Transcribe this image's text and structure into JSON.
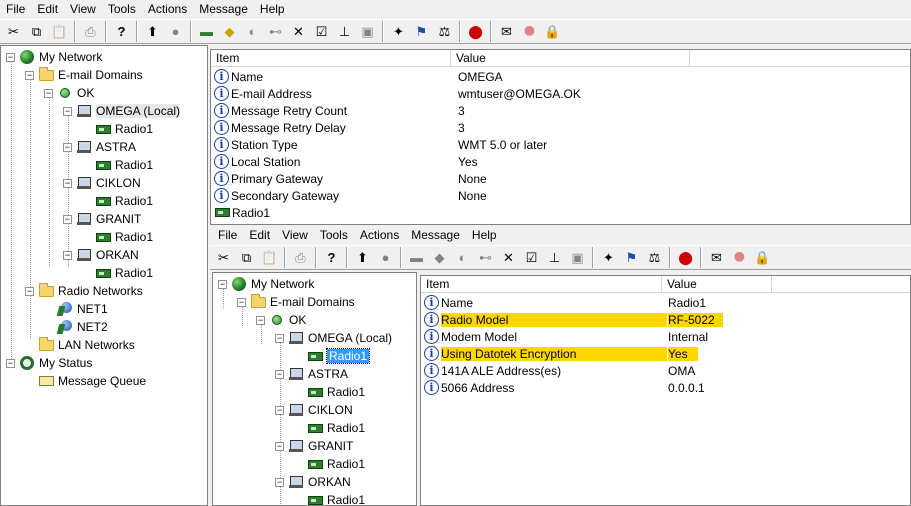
{
  "menu": {
    "file": "File",
    "edit": "Edit",
    "view": "View",
    "tools": "Tools",
    "actions": "Actions",
    "message": "Message",
    "help": "Help"
  },
  "tree": {
    "my_network": "My Network",
    "email_domains": "E-mail Domains",
    "ok": "OK",
    "stations": [
      {
        "name": "OMEGA (Local)",
        "radio": "Radio1"
      },
      {
        "name": "ASTRA",
        "radio": "Radio1"
      },
      {
        "name": "CIKLON",
        "radio": "Radio1"
      },
      {
        "name": "GRANIT",
        "radio": "Radio1"
      },
      {
        "name": "ORKAN",
        "radio": "Radio1"
      }
    ],
    "radio_networks": "Radio Networks",
    "nets": [
      "NET1",
      "NET2"
    ],
    "lan_networks": "LAN Networks",
    "my_status": "My Status",
    "message_queue": "Message Queue"
  },
  "top_list": {
    "headers": {
      "item": "Item",
      "value": "Value"
    },
    "rows": [
      {
        "item": "Name",
        "value": "OMEGA",
        "icon": "info-icon"
      },
      {
        "item": "E-mail Address",
        "value": "wmtuser@OMEGA.OK",
        "icon": "info-icon"
      },
      {
        "item": "Message Retry Count",
        "value": "3",
        "icon": "info-icon"
      },
      {
        "item": "Message Retry Delay",
        "value": "3",
        "icon": "info-icon"
      },
      {
        "item": "Station Type",
        "value": "WMT 5.0 or later",
        "icon": "info-icon"
      },
      {
        "item": "Local Station",
        "value": "Yes",
        "icon": "info-icon"
      },
      {
        "item": "Primary Gateway",
        "value": "None",
        "icon": "info-icon"
      },
      {
        "item": "Secondary Gateway",
        "value": "None",
        "icon": "info-icon"
      },
      {
        "item": "Radio1",
        "value": "",
        "icon": "radio-icon"
      }
    ]
  },
  "bottom_list": {
    "headers": {
      "item": "Item",
      "value": "Value"
    },
    "rows": [
      {
        "item": "Name",
        "value": "Radio1",
        "highlight": false
      },
      {
        "item": "Radio Model",
        "value": "RF-5022",
        "highlight": true
      },
      {
        "item": "Modem Model",
        "value": "Internal",
        "highlight": false
      },
      {
        "item": "Using Datotek Encryption",
        "value": "Yes",
        "highlight": true
      },
      {
        "item": "141A ALE Address(es)",
        "value": "OMA",
        "highlight": false
      },
      {
        "item": "5066 Address",
        "value": "0.0.0.1",
        "highlight": false
      }
    ]
  },
  "colors": {
    "highlight": "#ffd700",
    "selection": "#3399ff"
  }
}
